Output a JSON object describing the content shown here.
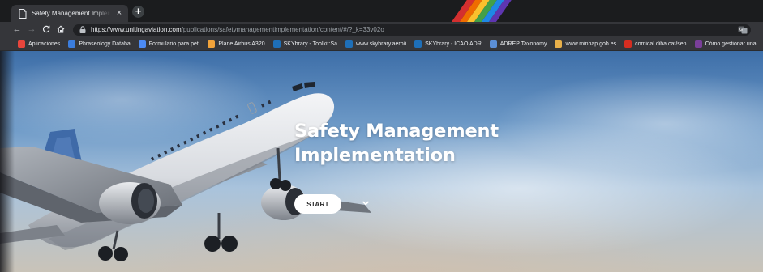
{
  "browser": {
    "tab": {
      "title": "Safety Management Implementatio",
      "close_glyph": "×",
      "favicon": "document-icon"
    },
    "new_tab_glyph": "+",
    "nav": {
      "back_glyph": "←",
      "forward_glyph": "→"
    },
    "url": {
      "host": "https://www.unitingaviation.com",
      "path": "/publications/safetymanagementimplementation/content/#/?_k=33v02o"
    },
    "bookmarks": [
      {
        "label": "Aplicaciones",
        "icon": "apps-grid-icon",
        "color": "#e8453c"
      },
      {
        "label": "Phraseology Databa",
        "icon": "flag-icon",
        "color": "#3b7ddd"
      },
      {
        "label": "Formulario para peti",
        "icon": "form-icon",
        "color": "#4c8bf5"
      },
      {
        "label": "Plane Airbus A320",
        "icon": "airbus-icon",
        "color": "#f2a33a"
      },
      {
        "label": "SKYbrary - Toolkit:Sa",
        "icon": "skybrary-icon",
        "color": "#1e6fb8"
      },
      {
        "label": "www.skybrary.aero/i",
        "icon": "skybrary-icon",
        "color": "#1e6fb8"
      },
      {
        "label": "SKYbrary - ICAO ADR",
        "icon": "skybrary-icon",
        "color": "#1e6fb8"
      },
      {
        "label": "ADREP Taxonomy",
        "icon": "adrep-icon",
        "color": "#5b8fd6"
      },
      {
        "label": "www.minhap.gob.es",
        "icon": "document-icon",
        "color": "#e8b04a"
      },
      {
        "label": "comical.diba.cat/sen",
        "icon": "diba-icon",
        "color": "#d62d20"
      },
      {
        "label": "Cómo gestionar una",
        "icon": "gestionar-icon",
        "color": "#7a3f9a"
      }
    ]
  },
  "hero": {
    "title_line1": "Safety Management",
    "title_line2": "Implementation",
    "start_label": "START",
    "chevron": "chevron-down-icon"
  }
}
